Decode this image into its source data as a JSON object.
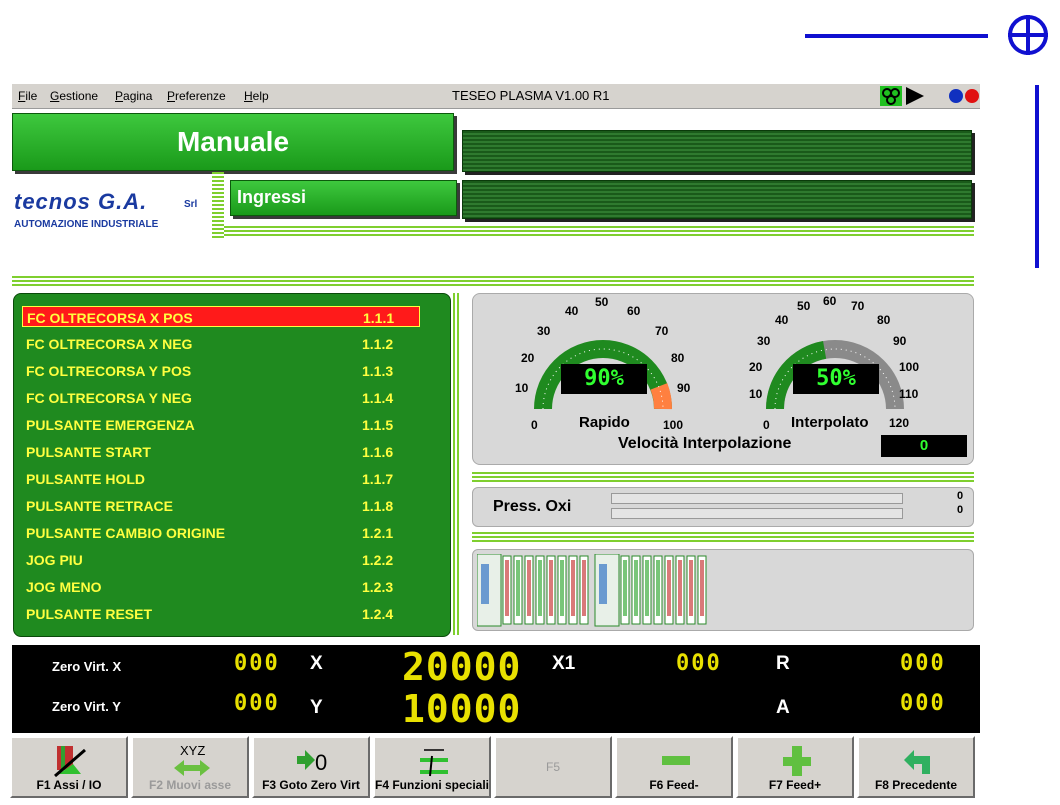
{
  "menu": {
    "items": [
      {
        "label": "File"
      },
      {
        "label": "Gestione"
      },
      {
        "label": "Pagina"
      },
      {
        "label": "Preferenze"
      },
      {
        "label": "Help"
      }
    ],
    "app_title": "TESEO PLASMA V1.00 R1"
  },
  "header": {
    "title": "Manuale",
    "subtitle": "Ingressi",
    "logo_main": "tecnos G.A.",
    "logo_srl": "Srl",
    "logo_sub": "AUTOMAZIONE INDUSTRIALE"
  },
  "io_list": [
    {
      "label": "FC OLTRECORSA X POS",
      "code": "1.1.1",
      "selected": true
    },
    {
      "label": "FC OLTRECORSA X NEG",
      "code": "1.1.2"
    },
    {
      "label": "FC OLTRECORSA Y POS",
      "code": "1.1.3"
    },
    {
      "label": "FC OLTRECORSA Y NEG",
      "code": "1.1.4"
    },
    {
      "label": "PULSANTE EMERGENZA",
      "code": "1.1.5"
    },
    {
      "label": "PULSANTE START",
      "code": "1.1.6"
    },
    {
      "label": "PULSANTE HOLD",
      "code": "1.1.7"
    },
    {
      "label": "PULSANTE RETRACE",
      "code": "1.1.8"
    },
    {
      "label": "PULSANTE CAMBIO ORIGINE",
      "code": "1.2.1"
    },
    {
      "label": "JOG PIU",
      "code": "1.2.2"
    },
    {
      "label": "JOG MENO",
      "code": "1.2.3"
    },
    {
      "label": "PULSANTE RESET",
      "code": "1.2.4"
    }
  ],
  "gauges": {
    "rapido": {
      "label": "Rapido",
      "value_text": "90%",
      "percent": 90,
      "ticks": [
        "0",
        "10",
        "20",
        "30",
        "40",
        "50",
        "60",
        "70",
        "80",
        "90",
        "100"
      ]
    },
    "interpolato": {
      "label": "Interpolato",
      "value_text": "50%",
      "percent": 50,
      "ticks": [
        "0",
        "10",
        "20",
        "30",
        "40",
        "50",
        "60",
        "70",
        "80",
        "90",
        "100",
        "110",
        "120"
      ]
    },
    "velocita_label": "Velocità Interpolazione",
    "velocita_value": "0"
  },
  "pressure": {
    "label": "Press. Oxi",
    "values": [
      "0",
      "0"
    ],
    "levels": [
      0,
      0
    ]
  },
  "dro": {
    "row1_label": "Zero Virt. X",
    "row2_label": "Zero Virt. Y",
    "zx_value": "000",
    "zy_value": "000",
    "axis_x": "X",
    "axis_y": "Y",
    "x_value": "20000",
    "y_value": "10000",
    "axis_x1": "X1",
    "x1_value": "000",
    "axis_r": "R",
    "r_value": "000",
    "axis_a": "A",
    "a_value": "000"
  },
  "fkeys": [
    {
      "label": "F1 Assi / IO",
      "icon": "io-slash-icon",
      "enabled": true
    },
    {
      "label": "F2 Muovi asse",
      "icon": "xyz-arrows-icon",
      "enabled": false
    },
    {
      "label": "F3 Goto Zero Virt",
      "icon": "goto-zero-icon",
      "enabled": true
    },
    {
      "label": "F4 Funzioni speciali",
      "icon": "special-functions-icon",
      "enabled": true
    },
    {
      "label": "F5",
      "icon": "",
      "enabled": false
    },
    {
      "label": "F6 Feed-",
      "icon": "minus-icon",
      "enabled": true
    },
    {
      "label": "F7 Feed+",
      "icon": "plus-icon",
      "enabled": true
    },
    {
      "label": "F8 Precedente",
      "icon": "back-arrow-icon",
      "enabled": true
    }
  ],
  "colors": {
    "panel_green": "#1f8a1f",
    "text_yellow": "#ffff40",
    "selected_red": "#ff1a1a",
    "lcd_green": "#30ff30",
    "segment_yellow": "#e8e000"
  }
}
